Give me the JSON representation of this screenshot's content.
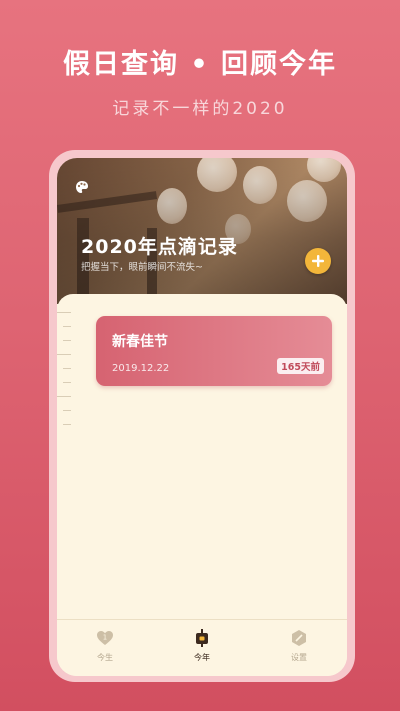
{
  "promo": {
    "headline": "假日查询 • 回顾今年",
    "subline": "记录不一样的2020"
  },
  "hero": {
    "title": "2020年点滴记录",
    "subtitle": "把握当下，眼前瞬间不流失~",
    "palette_icon": "palette-icon",
    "add_icon": "plus-icon"
  },
  "records": [
    {
      "title": "新春佳节",
      "date": "2019.12.22",
      "badge": "165天前"
    }
  ],
  "tabs": [
    {
      "label": "今生",
      "icon": "heart-badge-icon",
      "active": false
    },
    {
      "label": "今年",
      "icon": "calendar-tag-icon",
      "active": true
    },
    {
      "label": "设置",
      "icon": "settings-hex-icon",
      "active": false
    }
  ],
  "colors": {
    "background": "#de6472",
    "card": "#d66371",
    "add_button": "#f3b63a",
    "content_bg": "#fdf5e2"
  }
}
